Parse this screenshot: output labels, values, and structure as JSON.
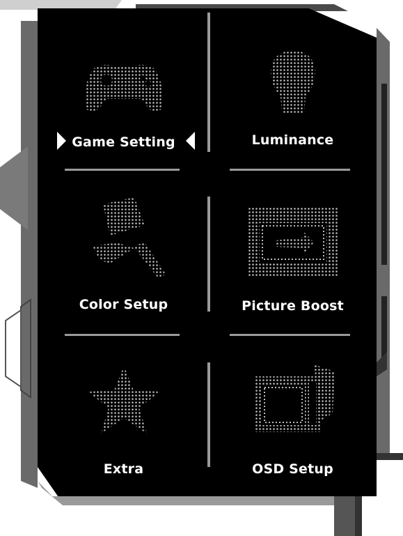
{
  "menu": {
    "items": [
      {
        "label": "Game Setting",
        "icon": "gamepad-icon",
        "selected": true
      },
      {
        "label": "Luminance",
        "icon": "lightbulb-icon",
        "selected": false
      },
      {
        "label": "Color Setup",
        "icon": "paint-roller-icon",
        "selected": false
      },
      {
        "label": "Picture Boost",
        "icon": "picture-boost-icon",
        "selected": false
      },
      {
        "label": "Extra",
        "icon": "star-icon",
        "selected": false
      },
      {
        "label": "OSD Setup",
        "icon": "osd-monitor-icon",
        "selected": false
      }
    ]
  },
  "colors": {
    "panel": "#000000",
    "text": "#ffffff",
    "divider": "#9a9a9a",
    "frame": "#555555"
  }
}
